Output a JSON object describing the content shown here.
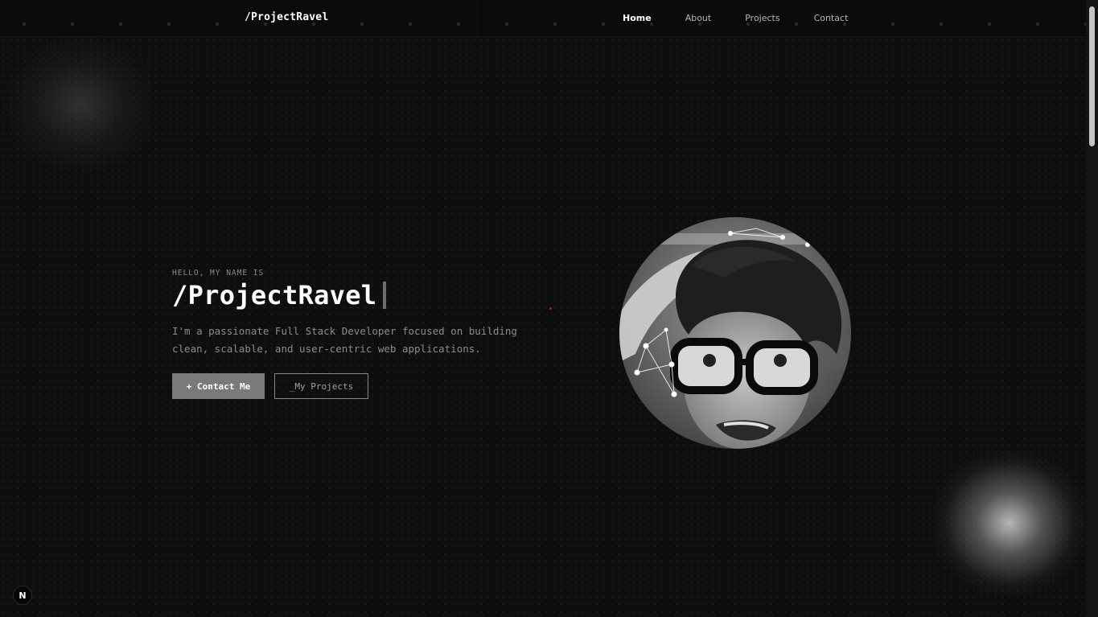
{
  "nav": {
    "brand": "/ProjectRavel",
    "links": [
      "Home",
      "About",
      "Projects",
      "Contact"
    ],
    "active": "Home"
  },
  "hero": {
    "greeting": "HELLO, MY NAME IS",
    "name": "/ProjectRavel",
    "description": "I'm a passionate Full Stack Developer focused on building clean, scalable, and user-centric web applications.",
    "primary_button": "+ Contact Me",
    "secondary_button": "_My Projects"
  },
  "portrait": {
    "icon": "profile-photo-grayscale"
  },
  "badge": {
    "label": "N",
    "icon": "nextjs-logo-icon"
  },
  "colors": {
    "background": "#0e0e0e",
    "primary_button": "#7a7a7a",
    "accent_dot": "#d01010"
  }
}
